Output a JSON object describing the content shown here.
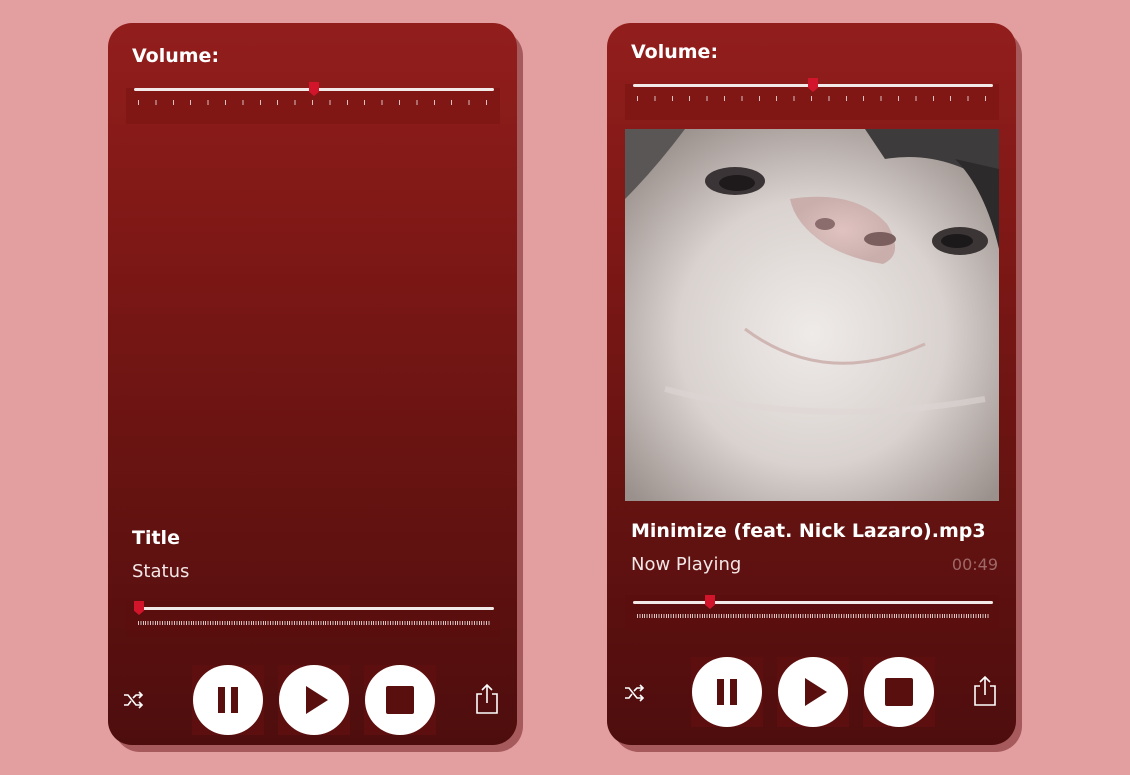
{
  "left_player": {
    "volume_label": "Volume:",
    "volume_level": 0.5,
    "title": "Title",
    "status": "Status",
    "progress": 0.0
  },
  "right_player": {
    "volume_label": "Volume:",
    "volume_level": 0.5,
    "title": "Minimize (feat. Nick Lazaro).mp3",
    "status": "Now Playing",
    "time": "00:49",
    "progress": 0.2,
    "album_art": "cat-closeup-image"
  },
  "icons": {
    "shuffle": "shuffle-icon",
    "pause": "pause-icon",
    "play": "play-icon",
    "stop": "stop-icon",
    "share": "share-icon"
  },
  "colors": {
    "page_background": "#e39ea0",
    "player_top": "#921e1c",
    "player_bottom": "#4e0d0d",
    "slider_thumb": "#d3152b",
    "button_fill": "#ffffff"
  }
}
